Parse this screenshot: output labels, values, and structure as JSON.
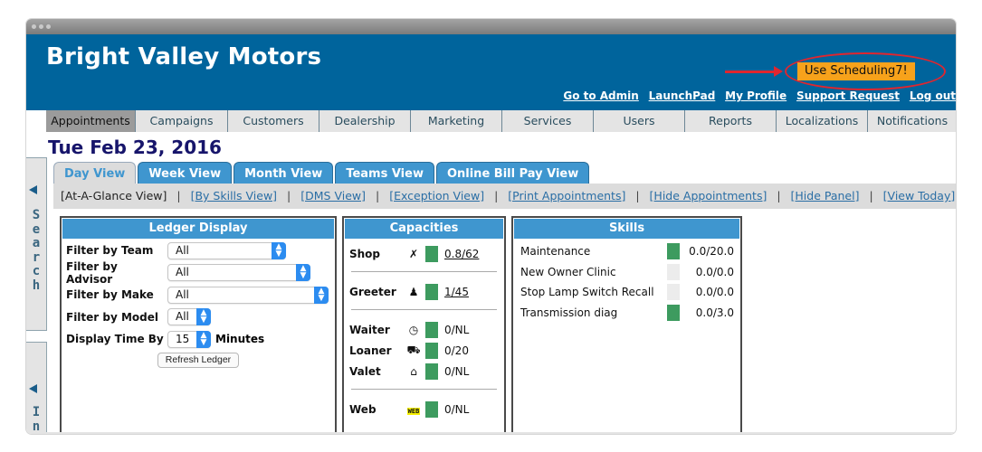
{
  "app": {
    "brand": "Bright Valley Motors",
    "cta_label": "Use Scheduling7!",
    "top_links": [
      "Go to Admin",
      "LaunchPad",
      "My Profile",
      "Support Request",
      "Log out"
    ]
  },
  "nav": {
    "items": [
      {
        "label": "Appointments",
        "active": true
      },
      {
        "label": "Campaigns"
      },
      {
        "label": "Customers"
      },
      {
        "label": "Dealership"
      },
      {
        "label": "Marketing"
      },
      {
        "label": "Services"
      },
      {
        "label": "Users"
      },
      {
        "label": "Reports"
      },
      {
        "label": "Localizations"
      },
      {
        "label": "Notifications"
      }
    ]
  },
  "date_title": "Tue Feb 23, 2016",
  "side_tabs": {
    "search": "Search",
    "info": "In"
  },
  "view_tabs": [
    {
      "label": "Day View",
      "active": true
    },
    {
      "label": "Week View"
    },
    {
      "label": "Month View"
    },
    {
      "label": "Teams View"
    },
    {
      "label": "Online Bill Pay View"
    }
  ],
  "sub_nav": {
    "current": "[At-A-Glance View]",
    "links": [
      "[By Skills View]",
      "[DMS View]",
      "[Exception View]",
      "[Print Appointments]",
      "[Hide Appointments]",
      "[Hide Panel]",
      "[View Today]"
    ],
    "separator": "|"
  },
  "ledger": {
    "title": "Ledger Display",
    "filters": [
      {
        "label": "Filter by Team",
        "value": "All"
      },
      {
        "label": "Filter by Advisor",
        "value": "All"
      },
      {
        "label": "Filter by Make",
        "value": "All"
      },
      {
        "label": "Filter by Model",
        "value": "All"
      },
      {
        "label": "Display Time By",
        "value": "15",
        "suffix": "Minutes"
      }
    ],
    "refresh_label": "Refresh Ledger"
  },
  "capacities": {
    "title": "Capacities",
    "rows": [
      {
        "label": "Shop",
        "icon": "wrench-icon",
        "glyph": "🔧",
        "value": "0.8/62",
        "link": true,
        "status_color": "#3d9b5f"
      },
      {
        "label": "Greeter",
        "icon": "person-icon",
        "glyph": "👤",
        "value": "1/45",
        "link": true,
        "status_color": "#3d9b5f"
      },
      {
        "label": "Waiter",
        "icon": "clock-icon",
        "glyph": "◷",
        "value": "0/NL",
        "status_color": "#3d9b5f"
      },
      {
        "label": "Loaner",
        "icon": "car-icon",
        "glyph": "🚘",
        "value": "0/20",
        "status_color": "#3d9b5f"
      },
      {
        "label": "Valet",
        "icon": "home-icon",
        "glyph": "⌂",
        "value": "0/NL",
        "status_color": "#3d9b5f"
      },
      {
        "label": "Web",
        "icon": "web-badge-icon",
        "glyph": "WEB",
        "value": "0/NL",
        "status_color": "#3d9b5f"
      }
    ]
  },
  "skills": {
    "title": "Skills",
    "rows": [
      {
        "name": "Maintenance",
        "value": "0.0/20.0",
        "status_color": "#3d9b5f"
      },
      {
        "name": "New Owner Clinic",
        "value": "0.0/0.0",
        "status_color": "#ececec"
      },
      {
        "name": "Stop Lamp Switch Recall",
        "value": "0.0/0.0",
        "status_color": "#ececec"
      },
      {
        "name": "Transmission diag",
        "value": "0.0/3.0",
        "status_color": "#3d9b5f"
      }
    ]
  },
  "colors": {
    "header_blue": "#00649c",
    "tab_blue": "#3f96cf",
    "cta_orange": "#f7a21b",
    "annotation_red": "#e0262f",
    "status_green": "#3d9b5f",
    "date_navy": "#17156b"
  }
}
